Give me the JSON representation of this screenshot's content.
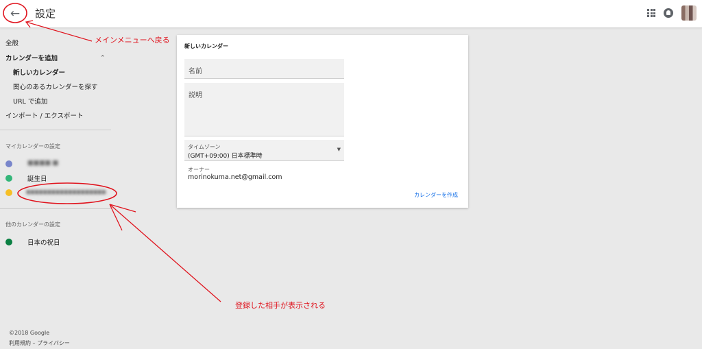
{
  "header": {
    "title": "設定",
    "back_icon": "arrow-left-icon",
    "apps_icon": "apps-grid-icon",
    "notifications_icon": "notifications-icon",
    "avatar_icon": "user-avatar"
  },
  "sidebar": {
    "general": "全般",
    "add_calendar": "カレンダーを追加",
    "new_calendar": "新しいカレンダー",
    "browse_calendars": "関心のあるカレンダーを探す",
    "add_by_url": "URL で追加",
    "import_export": "インポート / エクスポート",
    "my_calendars_heading": "マイカレンダーの設定",
    "my_calendars": [
      {
        "name": "■■■■ ■",
        "color": "#7986cb",
        "blurred": true
      },
      {
        "name": "誕生日",
        "color": "#33b679",
        "blurred": false
      },
      {
        "name": "■■■■■■■■■■■■■■■■■■■",
        "color": "#f6bf26",
        "blurred": true
      }
    ],
    "other_calendars_heading": "他のカレンダーの設定",
    "other_calendars": [
      {
        "name": "日本の祝日",
        "color": "#0b8043"
      }
    ],
    "footer_copyright": "©2018 Google",
    "footer_links": "利用規約 – プライバシー"
  },
  "card": {
    "title": "新しいカレンダー",
    "name_placeholder": "名前",
    "description_placeholder": "説明",
    "timezone_label": "タイムゾーン",
    "timezone_value": "(GMT+09:00) 日本標準時",
    "owner_label": "オーナー",
    "owner_value": "morinokuma.net@gmail.com",
    "create_button": "カレンダーを作成"
  },
  "annotations": {
    "main_menu_note": "メインメニューへ戻る",
    "registered_note": "登録した相手が表示される",
    "color": "#e0141e"
  }
}
